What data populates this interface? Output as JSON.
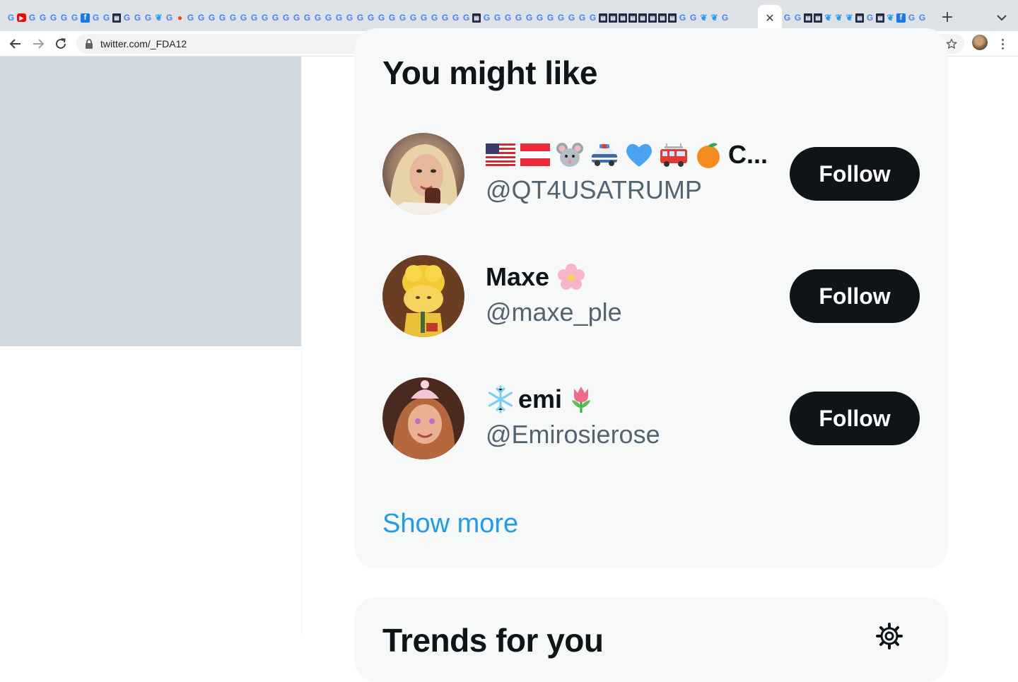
{
  "browser": {
    "url": "twitter.com/_FDA12",
    "active_tab_close": "✕",
    "new_tab_label": "+"
  },
  "recommendations": {
    "title": "You might like",
    "users": [
      {
        "display_name_text": "C...",
        "handle": "@QT4USATRUMP",
        "follow_label": "Follow",
        "name_emojis": [
          "us-flag-emoji",
          "austria-flag-emoji",
          "mouse-emoji",
          "police-car-emoji",
          "blue-heart-emoji",
          "fire-engine-emoji",
          "tangerine-emoji"
        ]
      },
      {
        "display_name_text": "Maxe",
        "handle": "@maxe_ple",
        "follow_label": "Follow",
        "name_emojis_after": [
          "cherry-blossom-emoji"
        ]
      },
      {
        "display_name_text": "emi",
        "handle": "@Emirosierose",
        "follow_label": "Follow",
        "name_emojis_before": [
          "snowflake-emoji"
        ],
        "name_emojis_after": [
          "tulip-emoji"
        ]
      }
    ],
    "show_more": "Show more"
  },
  "trends": {
    "title": "Trends for you"
  },
  "colors": {
    "follow_bg": "#0f1419",
    "link": "#1d9bf0",
    "handle": "#536471",
    "card_bg": "#f7f9f9",
    "banner": "#cfd9de"
  }
}
